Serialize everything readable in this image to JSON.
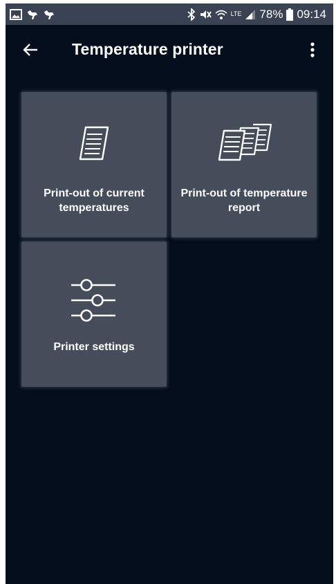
{
  "status_bar": {
    "battery_percent": "78%",
    "time": "09:14",
    "network": "LTE",
    "left_icons": [
      "image-icon",
      "bird-icon",
      "bird-icon"
    ],
    "right_icons": [
      "bluetooth-icon",
      "mute-icon",
      "wifi-icon",
      "lte-icon",
      "signal-icon",
      "battery-icon"
    ]
  },
  "app_bar": {
    "title": "Temperature printer",
    "back_icon": "arrow-left-icon",
    "menu_icon": "more-vertical-icon"
  },
  "tiles": [
    {
      "label": "Print-out of current temperatures",
      "icon": "document-icon"
    },
    {
      "label": "Print-out of temperature report",
      "icon": "documents-stack-icon"
    },
    {
      "label": "Printer settings",
      "icon": "sliders-icon"
    }
  ],
  "colors": {
    "background": "#030d1b",
    "status_bar": "#394353",
    "tile": "#454d5a",
    "text": "#ffffff"
  }
}
